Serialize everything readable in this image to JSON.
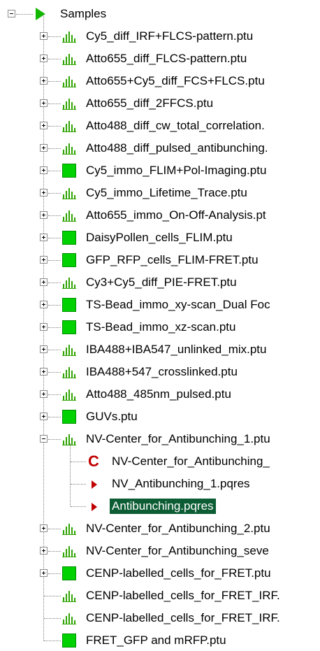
{
  "tree": {
    "root": {
      "label": "Samples",
      "icon": "green-triangle-icon"
    },
    "items": [
      {
        "label": "Cy5_diff_IRF+FLCS-pattern.ptu",
        "icon": "histogram-icon",
        "expander": "plus"
      },
      {
        "label": "Atto655_diff_FLCS-pattern.ptu",
        "icon": "histogram-icon",
        "expander": "plus"
      },
      {
        "label": "Atto655+Cy5_diff_FCS+FLCS.ptu",
        "icon": "histogram-icon",
        "expander": "plus"
      },
      {
        "label": "Atto655_diff_2FFCS.ptu",
        "icon": "histogram-icon",
        "expander": "plus"
      },
      {
        "label": "Atto488_diff_cw_total_correlation.",
        "icon": "histogram-icon",
        "expander": "plus"
      },
      {
        "label": "Atto488_diff_pulsed_antibunching.",
        "icon": "histogram-icon",
        "expander": "plus"
      },
      {
        "label": "Cy5_immo_FLIM+Pol-Imaging.ptu",
        "icon": "green-square-icon",
        "expander": "plus"
      },
      {
        "label": "Cy5_immo_Lifetime_Trace.ptu",
        "icon": "histogram-icon",
        "expander": "plus"
      },
      {
        "label": "Atto655_immo_On-Off-Analysis.pt",
        "icon": "histogram-icon",
        "expander": "plus"
      },
      {
        "label": "DaisyPollen_cells_FLIM.ptu",
        "icon": "green-square-icon",
        "expander": "plus"
      },
      {
        "label": "GFP_RFP_cells_FLIM-FRET.ptu",
        "icon": "green-square-icon",
        "expander": "plus"
      },
      {
        "label": "Cy3+Cy5_diff_PIE-FRET.ptu",
        "icon": "histogram-icon",
        "expander": "plus"
      },
      {
        "label": "TS-Bead_immo_xy-scan_Dual Foc",
        "icon": "green-square-icon",
        "expander": "plus"
      },
      {
        "label": "TS-Bead_immo_xz-scan.ptu",
        "icon": "green-square-icon",
        "expander": "plus"
      },
      {
        "label": "IBA488+IBA547_unlinked_mix.ptu",
        "icon": "histogram-icon",
        "expander": "plus"
      },
      {
        "label": "IBA488+547_crosslinked.ptu",
        "icon": "histogram-icon",
        "expander": "plus"
      },
      {
        "label": "Atto488_485nm_pulsed.ptu",
        "icon": "histogram-icon",
        "expander": "plus"
      },
      {
        "label": "GUVs.ptu",
        "icon": "green-square-icon",
        "expander": "plus"
      },
      {
        "label": "NV-Center_for_Antibunching_1.ptu",
        "icon": "histogram-icon",
        "expander": "minus"
      }
    ],
    "children": [
      {
        "label": "NV-Center_for_Antibunching_",
        "icon": "red-c-icon"
      },
      {
        "label": "NV_Antibunching_1.pqres",
        "icon": "red-triangle-icon"
      },
      {
        "label": "Antibunching.pqres",
        "icon": "red-triangle-icon",
        "selected": true
      }
    ],
    "items_after": [
      {
        "label": "NV-Center_for_Antibunching_2.ptu",
        "icon": "histogram-icon",
        "expander": "plus"
      },
      {
        "label": "NV-Center_for_Antibunching_seve",
        "icon": "histogram-icon",
        "expander": "plus"
      },
      {
        "label": "CENP-labelled_cells_for_FRET.ptu",
        "icon": "green-square-icon",
        "expander": "plus"
      },
      {
        "label": "CENP-labelled_cells_for_FRET_IRF.",
        "icon": "histogram-icon",
        "expander": "none"
      },
      {
        "label": "CENP-labelled_cells_for_FRET_IRF.",
        "icon": "histogram-icon",
        "expander": "none"
      },
      {
        "label": "FRET_GFP and mRFP.ptu",
        "icon": "green-square-icon",
        "expander": "none"
      }
    ],
    "colors": {
      "selection": "#0c5c34",
      "green_square": "#00d100",
      "histogram": "#2ea300",
      "red_icon": "#c00000"
    }
  }
}
